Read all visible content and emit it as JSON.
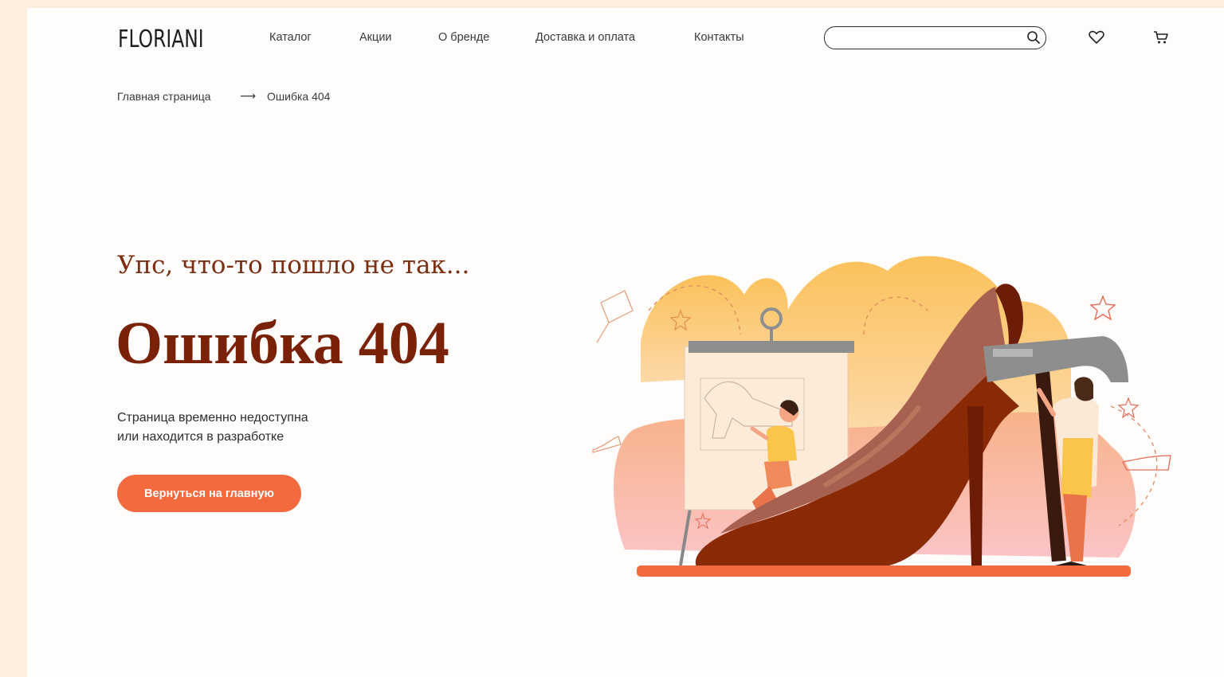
{
  "header": {
    "logo": "FLORIANI",
    "nav": [
      "Каталог",
      "Акции",
      "О бренде",
      "Доставка и оплата",
      "Контакты"
    ],
    "search_value": "",
    "icons": {
      "search": "search-icon",
      "wishlist": "heart-icon",
      "cart": "cart-icon"
    }
  },
  "breadcrumb": {
    "home": "Главная страница",
    "separator": "⟶",
    "current": "Ошибка 404"
  },
  "hero": {
    "subtitle": "Упс, что-то пошло не так...",
    "title": "Ошибка 404",
    "description_line1": "Страница временно недоступна",
    "description_line2": "или находится в разработке",
    "button": "Вернуться на главную"
  },
  "colors": {
    "accent": "#f26a3e",
    "headline": "#7a2208",
    "page_bg": "#fdeee0"
  }
}
